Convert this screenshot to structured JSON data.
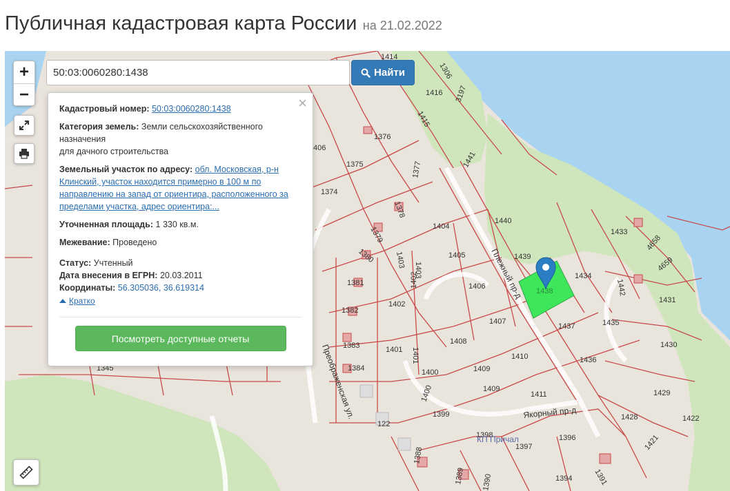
{
  "header": {
    "title": "Публичная кадастровая карта России",
    "date": "на 21.02.2022"
  },
  "search": {
    "value": "50:03:0060280:1438",
    "button_label": "Найти"
  },
  "controls": {
    "zoom_in": "+",
    "zoom_out": "−"
  },
  "popup": {
    "cadastral_label": "Кадастровый номер:",
    "cadastral_value": "50:03:0060280:1438",
    "category_label": "Категория земель:",
    "category_value_1": "Земли сельскохозяйственного",
    "category_value_2": "назначения",
    "category_value_3": "для дачного строительства",
    "address_label": "Земельный участок по адресу:",
    "address_value": "обл. Московская, р-н Клинский, участок находится примерно в 100 м по направлению на запад от ориентира, расположенного за пределами участка, адрес ориентира:...",
    "area_label": "Уточненная площадь:",
    "area_value": "1 330 кв.м.",
    "survey_label": "Межевание:",
    "survey_value": "Проведено",
    "status_label": "Статус:",
    "status_value": "Учтенный",
    "egrn_label": "Дата внесения в ЕГРН:",
    "egrn_value": "20.03.2011",
    "coords_label": "Координаты:",
    "coords_value": "56.305036, 36.619314",
    "brief_label": "Кратко",
    "report_button": "Посмотреть доступные отчеты"
  },
  "map": {
    "street_1": "Плежный пр-д",
    "street_2": "Якорный пр-д",
    "street_3": "Преображенская ул.",
    "place_label": "КП Причал",
    "parcels": [
      "1414",
      "1306",
      "1416",
      "3197",
      "1415",
      "1376",
      "1375",
      "1374",
      "1377",
      "1378",
      "1379",
      "1441",
      "1404",
      "1380",
      "1381",
      "1382",
      "1403",
      "1405",
      "1440",
      "1439",
      "1433",
      "4658",
      "4659",
      "1434",
      "1442",
      "1431",
      "1438",
      "1406",
      "1402",
      "1407",
      "1437",
      "1435",
      "1408",
      "1430",
      "1383",
      "1401",
      "1384",
      "1410",
      "1436",
      "1409",
      "1411",
      "1400",
      "1399",
      "1345",
      "122",
      "1398",
      "1397",
      "1396",
      "1428",
      "1429",
      "1422",
      "1421",
      "1388",
      "1389",
      "1390",
      "1394",
      "1391",
      "406"
    ],
    "colors": {
      "water": "#a8d4f2",
      "green": "#cfe6bc",
      "selected": "#3ee65a",
      "boundary": "#c94a4a",
      "marker": "#2b7ec4"
    }
  }
}
